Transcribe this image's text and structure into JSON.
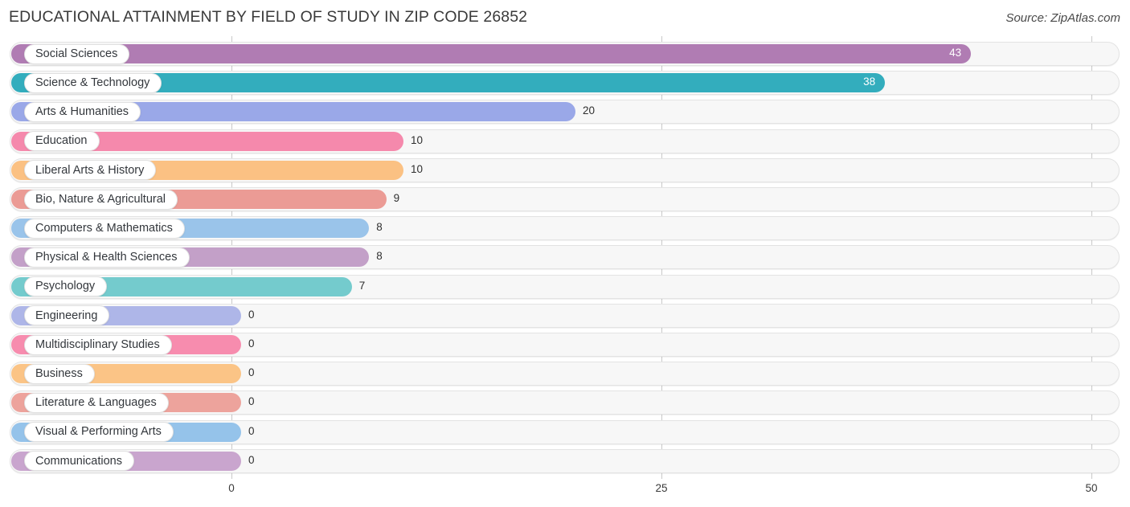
{
  "header": {
    "title": "EDUCATIONAL ATTAINMENT BY FIELD OF STUDY IN ZIP CODE 26852",
    "source": "Source: ZipAtlas.com"
  },
  "chart_data": {
    "type": "bar",
    "orientation": "horizontal",
    "title": "EDUCATIONAL ATTAINMENT BY FIELD OF STUDY IN ZIP CODE 26852",
    "xlabel": "",
    "ylabel": "",
    "xlim": [
      0,
      50
    ],
    "xticks": [
      0,
      25,
      50
    ],
    "xtick_labels": [
      "0",
      "25",
      "50"
    ],
    "grid": true,
    "legend": false,
    "categories": [
      "Social Sciences",
      "Science & Technology",
      "Arts & Humanities",
      "Education",
      "Liberal Arts & History",
      "Bio, Nature & Agricultural",
      "Computers & Mathematics",
      "Physical & Health Sciences",
      "Psychology",
      "Engineering",
      "Multidisciplinary Studies",
      "Business",
      "Literature & Languages",
      "Visual & Performing Arts",
      "Communications"
    ],
    "values": [
      43,
      38,
      20,
      10,
      10,
      9,
      8,
      8,
      7,
      0,
      0,
      0,
      0,
      0,
      0
    ],
    "value_labels": [
      "43",
      "38",
      "20",
      "10",
      "10",
      "9",
      "8",
      "8",
      "7",
      "0",
      "0",
      "0",
      "0",
      "0",
      "0"
    ],
    "colors": [
      "#b07cb3",
      "#33adbd",
      "#9aa8e8",
      "#f589ac",
      "#fbc183",
      "#eb9b95",
      "#9ac4ea",
      "#c3a0c8",
      "#74cbcd",
      "#aeb6e8",
      "#f78cae",
      "#fbc486",
      "#eda39c",
      "#95c3ea",
      "#c9a5ce"
    ],
    "label_inside": [
      true,
      true,
      false,
      false,
      false,
      false,
      false,
      false,
      false,
      false,
      false,
      false,
      false,
      false,
      false
    ]
  },
  "axis_tick_color": "#c9c9c9",
  "track_color": "#f7f7f7"
}
